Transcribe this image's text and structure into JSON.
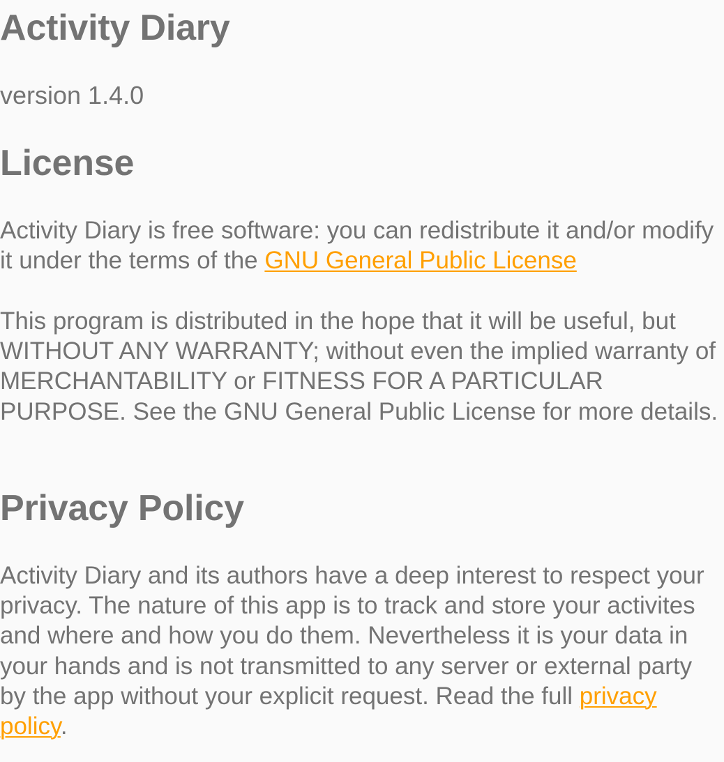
{
  "app": {
    "title": "Activity Diary",
    "version": "version 1.4.0"
  },
  "license": {
    "heading": "License",
    "p1_text": "Activity Diary is free software: you can redistribute it and/or modify it under the terms of the ",
    "p1_link": "GNU General Public License",
    "p2": "This program is distributed in the hope that it will be useful, but WITHOUT ANY WARRANTY; without even the implied warranty of MERCHANTABILITY or FITNESS FOR A PARTICULAR PURPOSE. See the GNU General Public License for more details."
  },
  "privacy": {
    "heading": "Privacy Policy",
    "text": "Activity Diary and its authors have a deep interest to respect your privacy. The nature of this app is to track and store your activites and where and how you do them. Nevertheless it is your data in your hands and is not transmitted to any server or external party by the app without your explicit request. Read the full ",
    "link": "privacy policy",
    "end": "."
  },
  "colors": {
    "text": "#737373",
    "link": "#ff9f00",
    "background": "#fafafa"
  }
}
